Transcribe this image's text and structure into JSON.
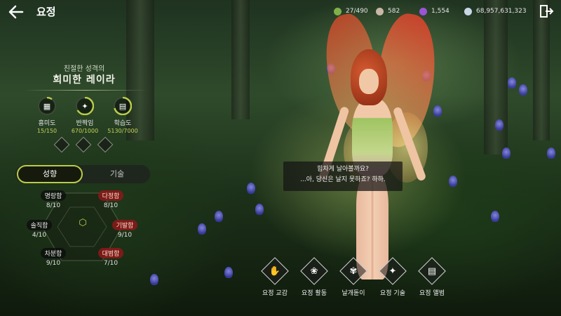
{
  "header": {
    "title": "요정",
    "currencies": [
      {
        "icon": "leaf-token-icon",
        "value": "27/490",
        "color": "#7fb04a"
      },
      {
        "icon": "orb-icon",
        "value": "582",
        "color": "#c9b8a6"
      },
      {
        "icon": "purple-crystal-icon",
        "value": "1,554",
        "color": "#9a54d6"
      },
      {
        "icon": "silver-coin-icon",
        "value": "68,957,631,323",
        "color": "#c9d6e6"
      }
    ]
  },
  "fairy": {
    "personality": "친절한 성격의",
    "name": "희미한 레이라",
    "stats": [
      {
        "icon": "book-stack-icon",
        "label": "흥미도",
        "value": "15/150",
        "progress": 0.1
      },
      {
        "icon": "sparkle-icon",
        "label": "반짝임",
        "value": "670/1000",
        "progress": 0.67
      },
      {
        "icon": "open-book-icon",
        "label": "학습도",
        "value": "5130/7000",
        "progress": 0.73
      }
    ]
  },
  "tabs": {
    "active": "성향",
    "inactive": "기술"
  },
  "traits": [
    {
      "name": "명랑함",
      "value": "8/10",
      "warn": false
    },
    {
      "name": "다정함",
      "value": "8/10",
      "warn": true
    },
    {
      "name": "솔직함",
      "value": "4/10",
      "warn": false
    },
    {
      "name": "기발함",
      "value": "9/10",
      "warn": true
    },
    {
      "name": "차분함",
      "value": "9/10",
      "warn": false
    },
    {
      "name": "대범함",
      "value": "7/10",
      "warn": true
    }
  ],
  "dialogue": {
    "line1": "힘차게 날아볼까요?",
    "line2": "...아, 당신은 날지 못하죠? 하하."
  },
  "actions": [
    {
      "icon": "fairy-hand-icon",
      "label": "요정 교감"
    },
    {
      "icon": "wings-icon",
      "label": "요정 활동"
    },
    {
      "icon": "butterfly-icon",
      "label": "날개돋이"
    },
    {
      "icon": "compass-star-icon",
      "label": "요정 기술"
    },
    {
      "icon": "album-book-icon",
      "label": "요정 앨범"
    }
  ],
  "colors": {
    "accent": "#b9cc4a",
    "warn": "#8c1919"
  }
}
